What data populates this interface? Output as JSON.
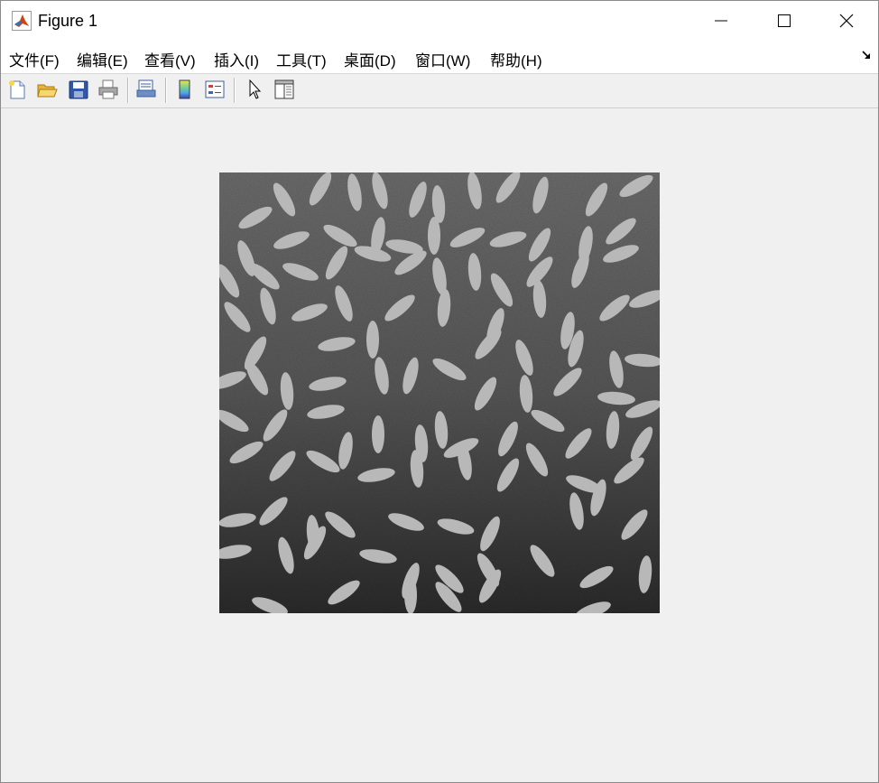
{
  "window": {
    "title": "Figure 1",
    "app_icon": "matlab-icon",
    "controls": [
      "minimize-icon",
      "maximize-icon",
      "close-icon"
    ]
  },
  "menubar": {
    "items": [
      "文件(F)",
      "编辑(E)",
      "查看(V)",
      "插入(I)",
      "工具(T)",
      "桌面(D)",
      "窗口(W)",
      "帮助(H)"
    ],
    "dock_icon": "dock-arrow-icon"
  },
  "toolbar": {
    "buttons": [
      "new-figure-icon",
      "open-file-icon",
      "save-figure-icon",
      "print-figure-icon",
      "link-plot-icon",
      "insert-colorbar-icon",
      "insert-legend-icon",
      "edit-plot-icon",
      "property-inspector-icon"
    ]
  },
  "figure": {
    "content": "grayscale-rice-grains-image",
    "colors": {
      "background": "#f0f0f0",
      "image_bg_dark": "#2c2c2c",
      "grain": "#b4b4b4"
    }
  }
}
